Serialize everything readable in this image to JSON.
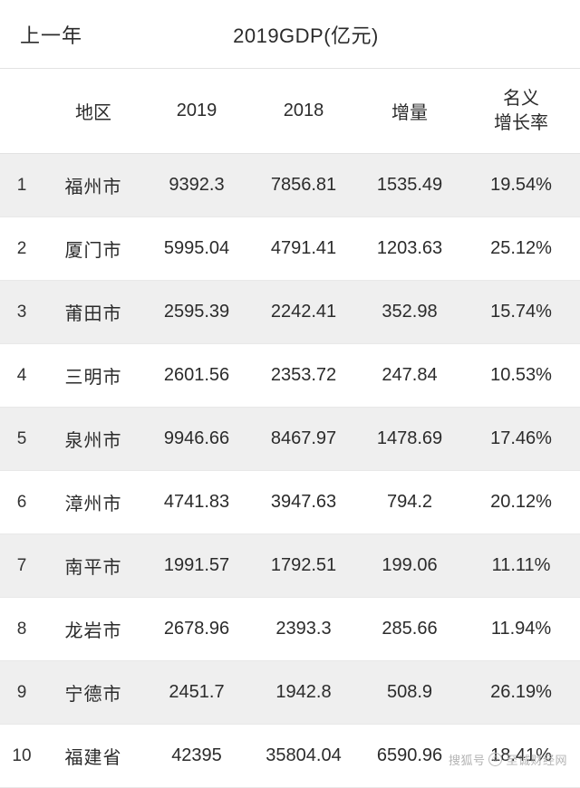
{
  "header": {
    "left_label": "上一年",
    "title": "2019GDP(亿元)"
  },
  "columns": {
    "rank": "",
    "area": "地区",
    "y2019": "2019",
    "y2018": "2018",
    "increment": "增量",
    "rate_line1": "名义",
    "rate_line2": "增长率"
  },
  "rows": [
    {
      "rank": "1",
      "area": "福州市",
      "y2019": "9392.3",
      "y2018": "7856.81",
      "increment": "1535.49",
      "rate": "19.54%"
    },
    {
      "rank": "2",
      "area": "厦门市",
      "y2019": "5995.04",
      "y2018": "4791.41",
      "increment": "1203.63",
      "rate": "25.12%"
    },
    {
      "rank": "3",
      "area": "莆田市",
      "y2019": "2595.39",
      "y2018": "2242.41",
      "increment": "352.98",
      "rate": "15.74%"
    },
    {
      "rank": "4",
      "area": "三明市",
      "y2019": "2601.56",
      "y2018": "2353.72",
      "increment": "247.84",
      "rate": "10.53%"
    },
    {
      "rank": "5",
      "area": "泉州市",
      "y2019": "9946.66",
      "y2018": "8467.97",
      "increment": "1478.69",
      "rate": "17.46%"
    },
    {
      "rank": "6",
      "area": "漳州市",
      "y2019": "4741.83",
      "y2018": "3947.63",
      "increment": "794.2",
      "rate": "20.12%"
    },
    {
      "rank": "7",
      "area": "南平市",
      "y2019": "1991.57",
      "y2018": "1792.51",
      "increment": "199.06",
      "rate": "11.11%"
    },
    {
      "rank": "8",
      "area": "龙岩市",
      "y2019": "2678.96",
      "y2018": "2393.3",
      "increment": "285.66",
      "rate": "11.94%"
    },
    {
      "rank": "9",
      "area": "宁德市",
      "y2019": "2451.7",
      "y2018": "1942.8",
      "increment": "508.9",
      "rate": "26.19%"
    },
    {
      "rank": "10",
      "area": "福建省",
      "y2019": "42395",
      "y2018": "35804.04",
      "increment": "6590.96",
      "rate": "18.41%"
    }
  ],
  "watermark": {
    "prefix": "搜狐号",
    "mark": "©",
    "suffix": "至诚财经网"
  }
}
